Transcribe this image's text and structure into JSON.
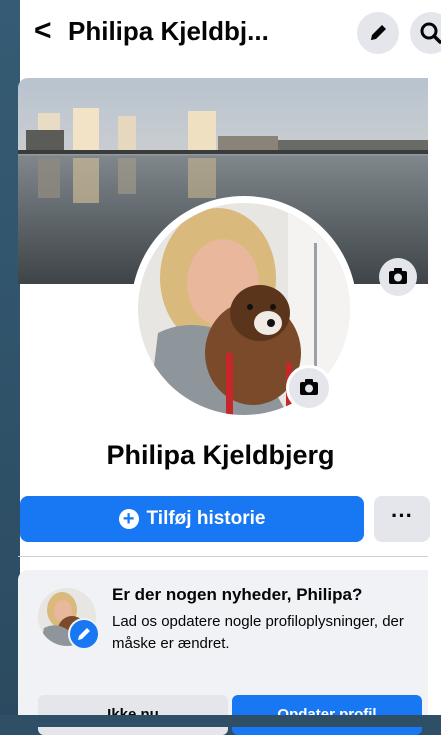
{
  "header": {
    "back_glyph": "<",
    "title": "Philipa Kjeldbj...",
    "edit_icon": "pencil-icon",
    "search_icon": "search-icon"
  },
  "cover": {
    "description_icon": "camera-icon"
  },
  "profile": {
    "name": "Philipa Kjeldbjerg",
    "avatar_camera_icon": "camera-icon"
  },
  "actions": {
    "add_story_label": "Tilføj historie",
    "more_label": "···"
  },
  "update_card": {
    "title": "Er der nogen nyheder, Philipa?",
    "body": "Lad os opdatere nogle profiloplysninger, der måske er ændret.",
    "skip_label": "Ikke nu",
    "update_label": "Opdater profil"
  },
  "colors": {
    "accent": "#1877f2",
    "secondary_button": "#e4e6eb",
    "card_bg": "#f0f2f5"
  }
}
